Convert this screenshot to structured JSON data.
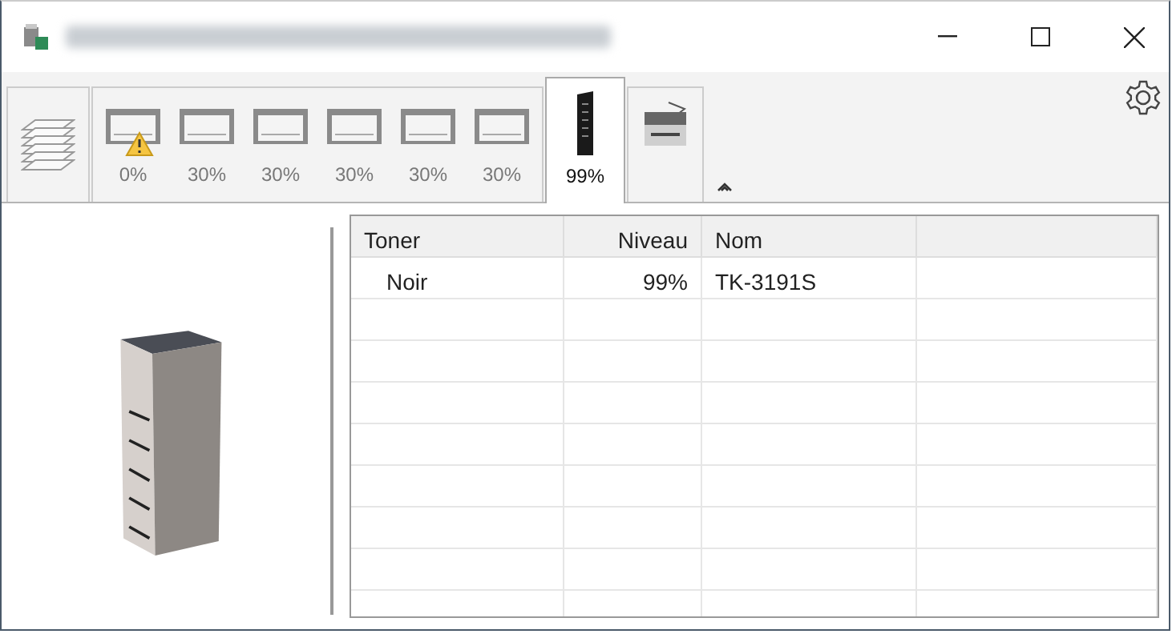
{
  "tabs": [
    {
      "kind": "paper",
      "selected": false
    },
    {
      "kind": "trays",
      "selected": false,
      "trays": [
        {
          "reading": "0%",
          "warning": true
        },
        {
          "reading": "30%",
          "warning": false
        },
        {
          "reading": "30%",
          "warning": false
        },
        {
          "reading": "30%",
          "warning": false
        },
        {
          "reading": "30%",
          "warning": false
        },
        {
          "reading": "30%",
          "warning": false
        }
      ]
    },
    {
      "kind": "toner",
      "selected": true,
      "reading": "99%"
    },
    {
      "kind": "device",
      "selected": false
    }
  ],
  "table": {
    "columns": [
      "Toner",
      "Niveau",
      "Nom"
    ],
    "rows": [
      {
        "cells": [
          "Noir",
          "99%",
          "TK-3191S"
        ]
      }
    ]
  }
}
